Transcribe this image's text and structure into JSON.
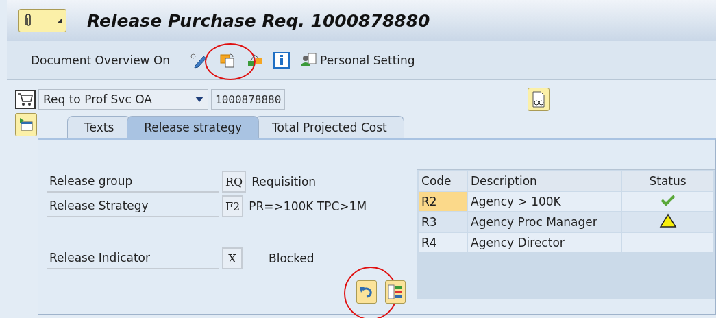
{
  "window": {
    "title": "Release Purchase Req. 1000878880"
  },
  "toolbar": {
    "items": [
      {
        "kind": "text",
        "label": "Document Overview On",
        "circled": false
      },
      {
        "kind": "separator"
      },
      {
        "kind": "edit",
        "circled": false
      },
      {
        "kind": "copy",
        "circled": true
      },
      {
        "kind": "structure",
        "circled": false
      },
      {
        "kind": "info",
        "circled": false
      },
      {
        "kind": "person",
        "label": "Personal Setting",
        "circled": false
      }
    ]
  },
  "header": {
    "document_type": "Req to Prof Svc OA",
    "number": "1000878880"
  },
  "tabs": [
    {
      "label": "Texts",
      "selected": false
    },
    {
      "label": "Release strategy",
      "selected": true
    },
    {
      "label": "Total Projected Cost",
      "selected": false
    }
  ],
  "release": {
    "fields": [
      {
        "label": "Release group",
        "code": "RQ",
        "text": "Requisition"
      },
      {
        "label": "Release Strategy",
        "code": "F2",
        "text": "PR=>100K TPC>1M"
      },
      {
        "label": "Release Indicator",
        "code": "X",
        "text": "Blocked"
      }
    ],
    "buttons": [
      {
        "kind": "undo",
        "circled": true
      },
      {
        "kind": "list",
        "circled": false
      }
    ]
  },
  "table": {
    "columns": [
      "Code",
      "Description",
      "Status"
    ],
    "rows": [
      {
        "code": "R2",
        "description": "Agency > 100K",
        "kind": "released",
        "selected": true
      },
      {
        "code": "R3",
        "description": "Agency Proc Manager",
        "kind": "pending",
        "selected": false
      },
      {
        "code": "R4",
        "description": "Agency Director",
        "kind": "open",
        "selected": false
      }
    ]
  }
}
